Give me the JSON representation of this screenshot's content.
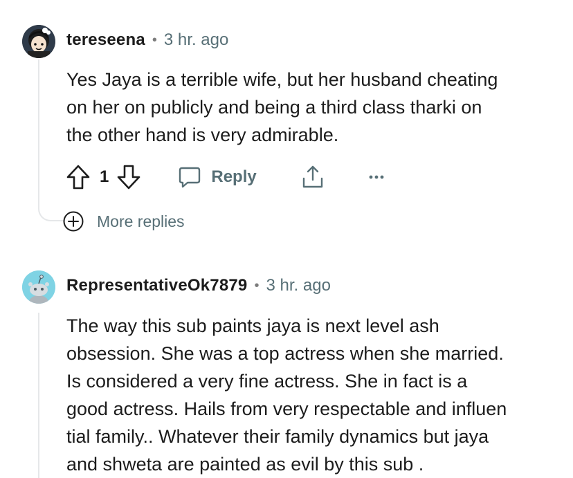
{
  "comments": [
    {
      "username": "tereseena",
      "separator": "•",
      "time": "3 hr. ago",
      "body": "Yes Jaya is a terrible wife, but her husband cheating\non her on publicly and being a third class tharki on\nthe other hand is very admirable.",
      "avatar_icon": "cartoon-avatar-icon",
      "actions": {
        "upvote_icon": "upvote-arrow-icon",
        "vote_count": "1",
        "downvote_icon": "downvote-arrow-icon",
        "reply_label": "Reply",
        "share_icon": "share-icon",
        "more_icon": "ellipsis-icon"
      },
      "more_replies_label": "More replies"
    },
    {
      "username": "RepresentativeOk7879",
      "separator": "•",
      "time": "3 hr. ago",
      "body": "The way this sub paints jaya is next level ash\nobsession. She was a top actress when she married.\nIs considered a very fine actress. She in fact is a\ngood actress. Hails from very respectable and influen\ntial family.. Whatever their family dynamics but jaya\nand shweta are painted as evil by this sub .",
      "avatar_icon": "snoo-avatar-icon"
    }
  ],
  "colors": {
    "text": "#1c1c1c",
    "muted": "#576f76",
    "thread_line": "#e5e7e9",
    "avatar2_bg": "#7fd3e4"
  }
}
